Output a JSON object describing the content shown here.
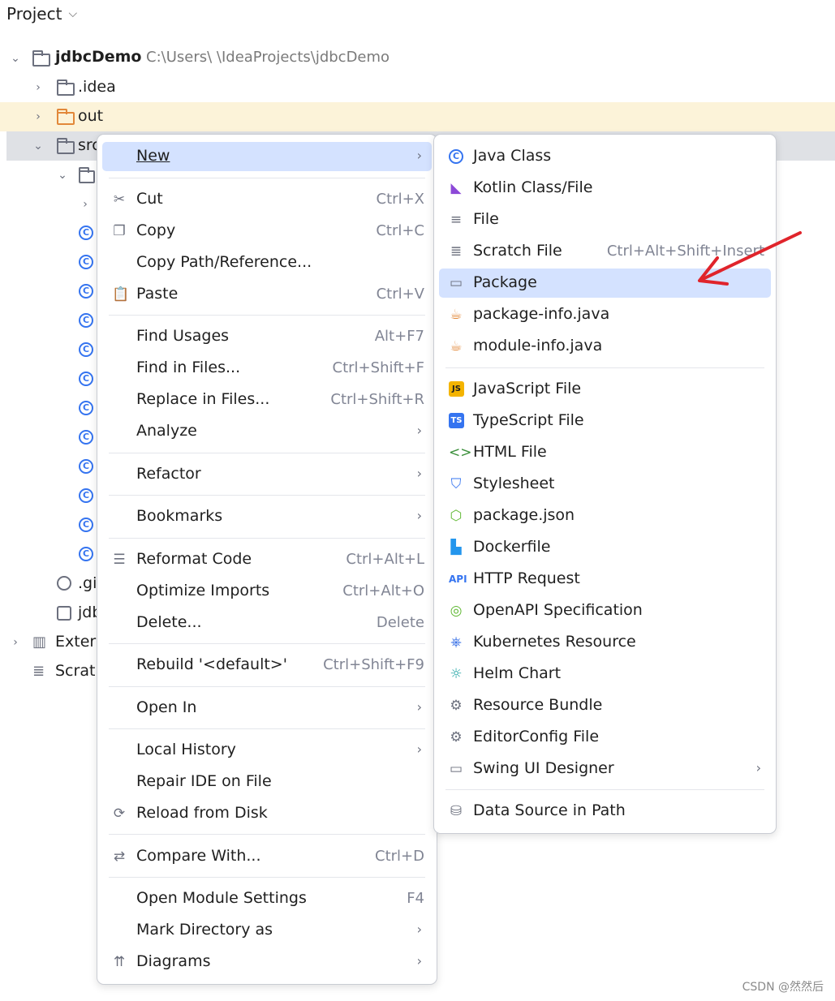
{
  "project_header": {
    "title": "Project",
    "caret": "⌵"
  },
  "tree": {
    "root_name": "jdbcDemo",
    "root_path": "C:\\Users\\ \\IdeaProjects\\jdbcDemo",
    "idea": ".idea",
    "out": "out",
    "src": "src",
    "gitignore": ".gi",
    "iml": "jdb",
    "external": "Exter",
    "scratches": "Scrat",
    "class_icon_glyph": "C",
    "class_count": 12
  },
  "context_menu": {
    "items": [
      {
        "label": "New",
        "shortcut": "",
        "submenu": true,
        "icon": ""
      },
      {
        "label": "Cut",
        "shortcut": "Ctrl+X",
        "submenu": false,
        "icon": "scissors-icon"
      },
      {
        "label": "Copy",
        "shortcut": "Ctrl+C",
        "submenu": false,
        "icon": "copy-icon"
      },
      {
        "label": "Copy Path/Reference...",
        "shortcut": "",
        "submenu": false,
        "icon": ""
      },
      {
        "label": "Paste",
        "shortcut": "Ctrl+V",
        "submenu": false,
        "icon": "paste-icon"
      },
      {
        "label": "Find Usages",
        "shortcut": "Alt+F7",
        "submenu": false,
        "icon": ""
      },
      {
        "label": "Find in Files...",
        "shortcut": "Ctrl+Shift+F",
        "submenu": false,
        "icon": ""
      },
      {
        "label": "Replace in Files...",
        "shortcut": "Ctrl+Shift+R",
        "submenu": false,
        "icon": ""
      },
      {
        "label": "Analyze",
        "shortcut": "",
        "submenu": true,
        "icon": ""
      },
      {
        "label": "Refactor",
        "shortcut": "",
        "submenu": true,
        "icon": ""
      },
      {
        "label": "Bookmarks",
        "shortcut": "",
        "submenu": true,
        "icon": ""
      },
      {
        "label": "Reformat Code",
        "shortcut": "Ctrl+Alt+L",
        "submenu": false,
        "icon": "reformat-icon"
      },
      {
        "label": "Optimize Imports",
        "shortcut": "Ctrl+Alt+O",
        "submenu": false,
        "icon": ""
      },
      {
        "label": "Delete...",
        "shortcut": "Delete",
        "submenu": false,
        "icon": ""
      },
      {
        "label": "Rebuild '<default>'",
        "shortcut": "Ctrl+Shift+F9",
        "submenu": false,
        "icon": ""
      },
      {
        "label": "Open In",
        "shortcut": "",
        "submenu": true,
        "icon": ""
      },
      {
        "label": "Local History",
        "shortcut": "",
        "submenu": true,
        "icon": ""
      },
      {
        "label": "Repair IDE on File",
        "shortcut": "",
        "submenu": false,
        "icon": ""
      },
      {
        "label": "Reload from Disk",
        "shortcut": "",
        "submenu": false,
        "icon": "reload-icon"
      },
      {
        "label": "Compare With...",
        "shortcut": "Ctrl+D",
        "submenu": false,
        "icon": "compare-icon"
      },
      {
        "label": "Open Module Settings",
        "shortcut": "F4",
        "submenu": false,
        "icon": ""
      },
      {
        "label": "Mark Directory as",
        "shortcut": "",
        "submenu": true,
        "icon": ""
      },
      {
        "label": "Diagrams",
        "shortcut": "",
        "submenu": true,
        "icon": "diagram-icon"
      }
    ]
  },
  "new_submenu": {
    "items": [
      {
        "label": "Java Class",
        "shortcut": ""
      },
      {
        "label": "Kotlin Class/File",
        "shortcut": ""
      },
      {
        "label": "File",
        "shortcut": ""
      },
      {
        "label": "Scratch File",
        "shortcut": "Ctrl+Alt+Shift+Insert"
      },
      {
        "label": "Package",
        "shortcut": ""
      },
      {
        "label": "package-info.java",
        "shortcut": ""
      },
      {
        "label": "module-info.java",
        "shortcut": ""
      },
      {
        "label": "JavaScript File",
        "shortcut": ""
      },
      {
        "label": "TypeScript File",
        "shortcut": ""
      },
      {
        "label": "HTML File",
        "shortcut": ""
      },
      {
        "label": "Stylesheet",
        "shortcut": ""
      },
      {
        "label": "package.json",
        "shortcut": ""
      },
      {
        "label": "Dockerfile",
        "shortcut": ""
      },
      {
        "label": "HTTP Request",
        "shortcut": ""
      },
      {
        "label": "OpenAPI Specification",
        "shortcut": ""
      },
      {
        "label": "Kubernetes Resource",
        "shortcut": ""
      },
      {
        "label": "Helm Chart",
        "shortcut": ""
      },
      {
        "label": "Resource Bundle",
        "shortcut": ""
      },
      {
        "label": "EditorConfig File",
        "shortcut": ""
      },
      {
        "label": "Swing UI Designer",
        "shortcut": ""
      },
      {
        "label": "Data Source in Path",
        "shortcut": ""
      }
    ],
    "badges": {
      "js": "JS",
      "ts": "TS",
      "api": "API"
    }
  },
  "colors": {
    "selection": "#d4e2ff",
    "accent": "#3574f0",
    "arrow": "#e0242b",
    "out_row": "#fcf3d9"
  },
  "watermark": "CSDN @然然后"
}
